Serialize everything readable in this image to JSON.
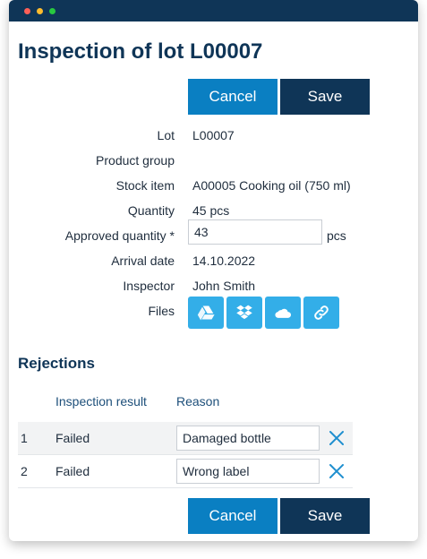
{
  "header": {
    "title": "Inspection of lot L00007"
  },
  "actions": {
    "cancel_label": "Cancel",
    "save_label": "Save"
  },
  "form": {
    "lot": {
      "label": "Lot",
      "value": "L00007"
    },
    "product_group": {
      "label": "Product group",
      "value": ""
    },
    "stock_item": {
      "label": "Stock item",
      "value": "A00005 Cooking oil (750 ml)"
    },
    "quantity": {
      "label": "Quantity",
      "value": "45 pcs"
    },
    "approved_quantity": {
      "label": "Approved quantity *",
      "value": "43",
      "unit": "pcs"
    },
    "arrival_date": {
      "label": "Arrival date",
      "value": "14.10.2022"
    },
    "inspector": {
      "label": "Inspector",
      "value": "John Smith"
    },
    "files": {
      "label": "Files",
      "icons": [
        "google-drive-icon",
        "dropbox-icon",
        "onedrive-icon",
        "link-icon"
      ]
    }
  },
  "rejections": {
    "title": "Rejections",
    "columns": {
      "result": "Inspection result",
      "reason": "Reason"
    },
    "rows": [
      {
        "num": "1",
        "result": "Failed",
        "reason": "Damaged bottle"
      },
      {
        "num": "2",
        "result": "Failed",
        "reason": "Wrong label"
      }
    ]
  },
  "colors": {
    "primary": "#0a7fc2",
    "dark": "#0f3557",
    "file_button": "#33aee8"
  }
}
